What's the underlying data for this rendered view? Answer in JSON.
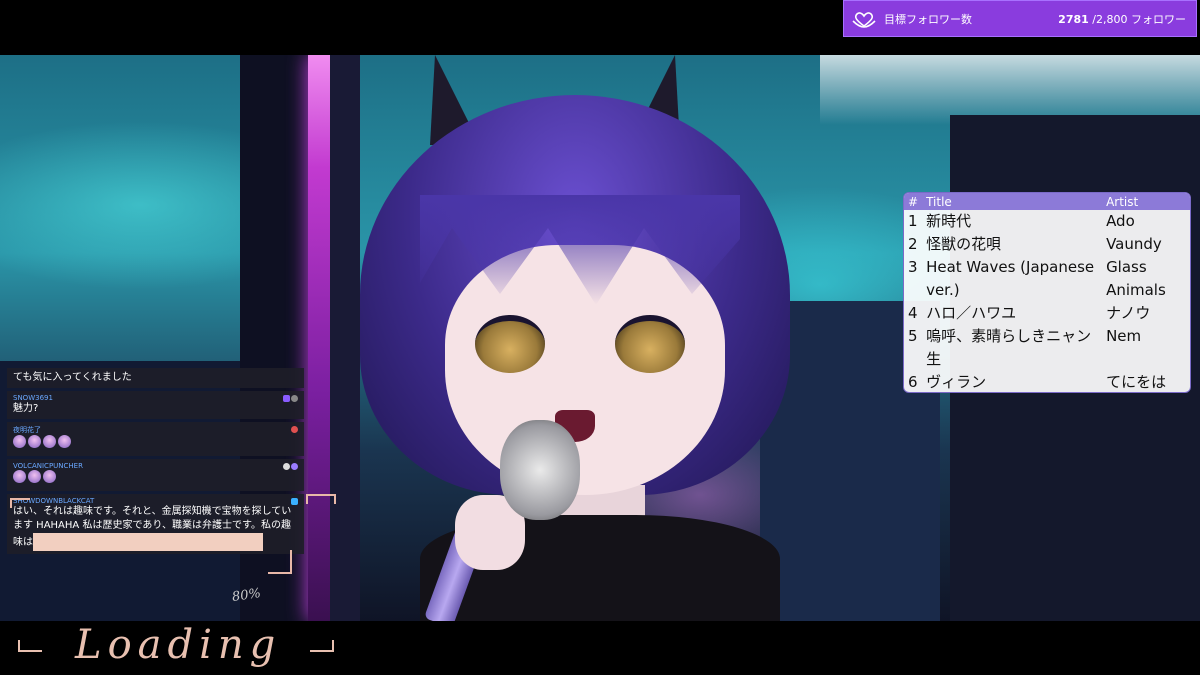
{
  "goal": {
    "label": "目標フォロワー数",
    "current": "2781",
    "target_text": "/2,800 フォロワー",
    "icon": "heart-hands-icon",
    "color": "#8a3cde"
  },
  "setlist": {
    "headers": {
      "num": "#",
      "title": "Title",
      "artist": "Artist"
    },
    "rows": [
      {
        "num": "1",
        "title": "新時代",
        "artist": "Ado"
      },
      {
        "num": "2",
        "title": "怪獣の花唄",
        "artist": "Vaundy"
      },
      {
        "num": "3",
        "title": "Heat Waves (Japanese ver.)",
        "artist": "Glass Animals"
      },
      {
        "num": "4",
        "title": "ハロ／ハワユ",
        "artist": "ナノウ"
      },
      {
        "num": "5",
        "title": "嗚呼、素晴らしきニャン生",
        "artist": "Nem"
      },
      {
        "num": "6",
        "title": "ヴィラン",
        "artist": "てにをは"
      }
    ],
    "header_color": "#8c7ad8"
  },
  "chat": {
    "messages": [
      {
        "user": "",
        "text": "ても気に入ってくれました"
      },
      {
        "user": "SNOW3691",
        "text": "魅力?"
      },
      {
        "user": "夜明花了",
        "text": ""
      },
      {
        "user": "VOLCANICPUNCHER",
        "text": ""
      },
      {
        "user": "SHOWDOWNBLACKCAT",
        "text": "はい、それは趣味です。それと、金属探知機で宝物を探しています HAHAHA 私は歴史家であり、職業は弁護士です。私の趣味は"
      }
    ]
  },
  "overlay": {
    "loading_text": "Loading",
    "percent_text": "80%"
  }
}
